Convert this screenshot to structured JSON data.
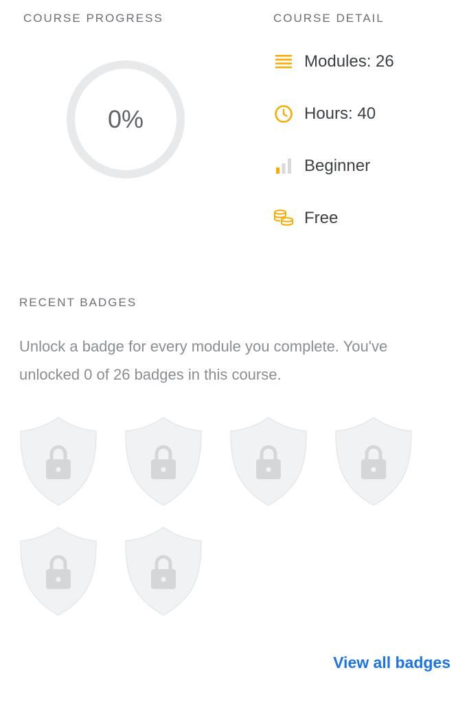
{
  "progress": {
    "heading": "COURSE PROGRESS",
    "percent_label": "0%",
    "percent_value": 0
  },
  "detail": {
    "heading": "COURSE DETAIL",
    "items": [
      {
        "icon": "list-lines-icon",
        "label": "Modules: 26"
      },
      {
        "icon": "clock-icon",
        "label": "Hours: 40"
      },
      {
        "icon": "level-bars-icon",
        "label": "Beginner"
      },
      {
        "icon": "coins-icon",
        "label": "Free"
      }
    ]
  },
  "badges": {
    "heading": "RECENT BADGES",
    "description": "Unlock a badge for every module you complete. You've unlocked 0 of 26 badges in this course.",
    "items": [
      {
        "icon": "locked-shield-icon"
      },
      {
        "icon": "locked-shield-icon"
      },
      {
        "icon": "locked-shield-icon"
      },
      {
        "icon": "locked-shield-icon"
      },
      {
        "icon": "locked-shield-icon"
      },
      {
        "icon": "locked-shield-icon"
      }
    ],
    "view_all_label": "View all badges"
  },
  "colors": {
    "accent": "#f9ab00",
    "link": "#1a73e8",
    "ring_track": "#e8e9eb",
    "badge_fill": "#f1f2f3",
    "lock": "#d4d6d8"
  }
}
